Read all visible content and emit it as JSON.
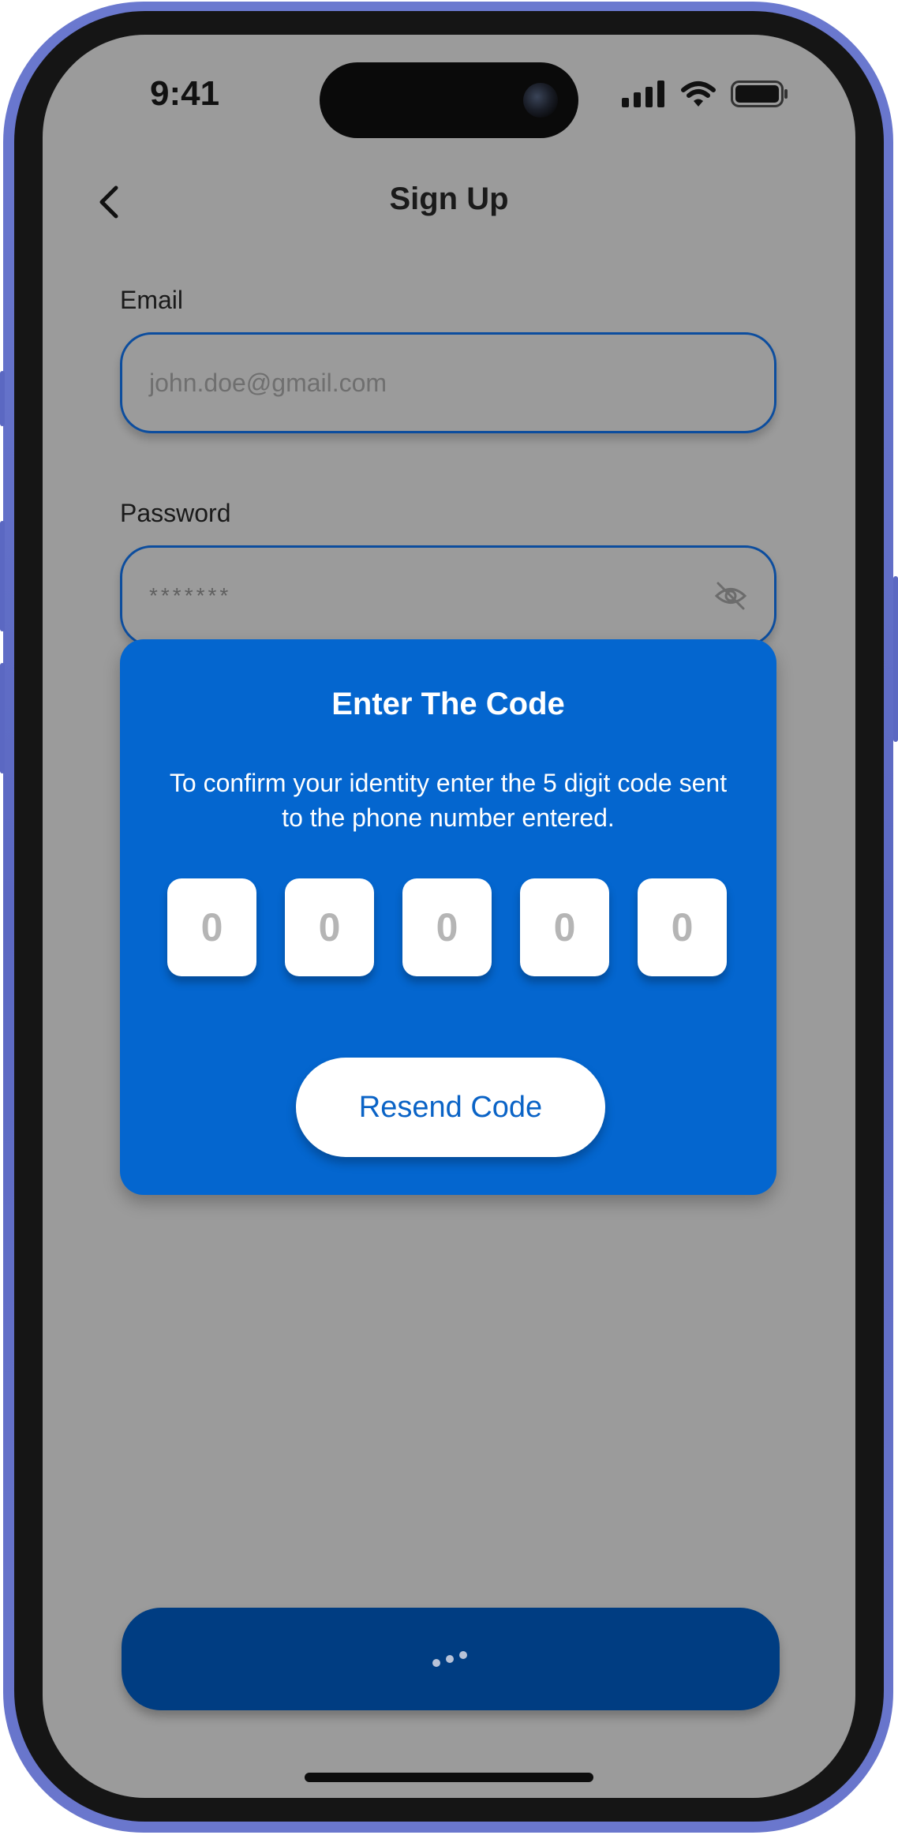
{
  "status_bar": {
    "time": "9:41",
    "icons": [
      "cellular-signal-icon",
      "wifi-icon",
      "battery-icon"
    ]
  },
  "header": {
    "back_icon": "chevron-left-icon",
    "title": "Sign Up"
  },
  "form": {
    "email": {
      "label": "Email",
      "value": "",
      "placeholder": "john.doe@gmail.com"
    },
    "password": {
      "label": "Password",
      "value": "*******",
      "toggle_icon": "eye-off-icon"
    }
  },
  "modal": {
    "title": "Enter The Code",
    "description": "To confirm your identity enter the 5 digit code sent to the phone number entered.",
    "digits": [
      "0",
      "0",
      "0",
      "0",
      "0"
    ],
    "resend_label": "Resend Code"
  },
  "primary_button": {
    "icon": "loading-dots-icon"
  },
  "colors": {
    "modal_background": "#0466cf",
    "primary_button": "#003d82",
    "screen_overlay": "#9b9b9b",
    "field_border": "#0c4d9e",
    "accent_text": "#0a63c6",
    "device_frame": "#5b68c2"
  }
}
